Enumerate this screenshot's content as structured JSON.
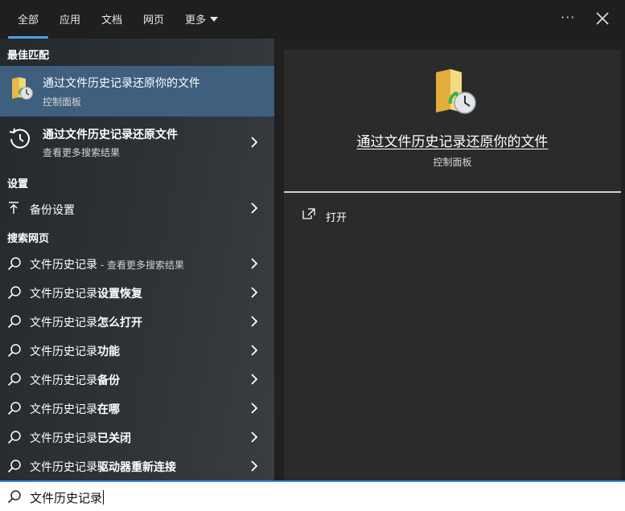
{
  "tabs": [
    {
      "label": "全部",
      "active": true
    },
    {
      "label": "应用"
    },
    {
      "label": "文档"
    },
    {
      "label": "网页"
    },
    {
      "label": "更多"
    }
  ],
  "top_actions": {
    "more_glyph": "···"
  },
  "best_match": {
    "heading": "最佳匹配",
    "title": "通过文件历史记录还原你的文件",
    "subtitle": "控制面板"
  },
  "second_result": {
    "title": "通过文件历史记录还原文件",
    "subtitle": "查看更多搜索结果"
  },
  "settings": {
    "heading": "设置",
    "items": [
      {
        "label": "备份设置"
      }
    ]
  },
  "web": {
    "heading": "搜索网页",
    "items": [
      {
        "pre": "文件历史记录",
        "suffix": "",
        "dim": " - 查看更多搜索结果"
      },
      {
        "pre": "文件历史记录",
        "suffix": "设置恢复",
        "dim": ""
      },
      {
        "pre": "文件历史记录",
        "suffix": "怎么打开",
        "dim": ""
      },
      {
        "pre": "文件历史记录",
        "suffix": "功能",
        "dim": ""
      },
      {
        "pre": "文件历史记录",
        "suffix": "备份",
        "dim": ""
      },
      {
        "pre": "文件历史记录",
        "suffix": "在哪",
        "dim": ""
      },
      {
        "pre": "文件历史记录",
        "suffix": "已关闭",
        "dim": ""
      },
      {
        "pre": "文件历史记录",
        "suffix": "驱动器重新连接",
        "dim": ""
      }
    ]
  },
  "preview": {
    "title": "通过文件历史记录还原你的文件",
    "subtitle": "控制面板",
    "open_label": "打开"
  },
  "search": {
    "value": "文件历史记录"
  },
  "colors": {
    "accent": "#4aa0e6",
    "selected": "#3e5f7d"
  }
}
